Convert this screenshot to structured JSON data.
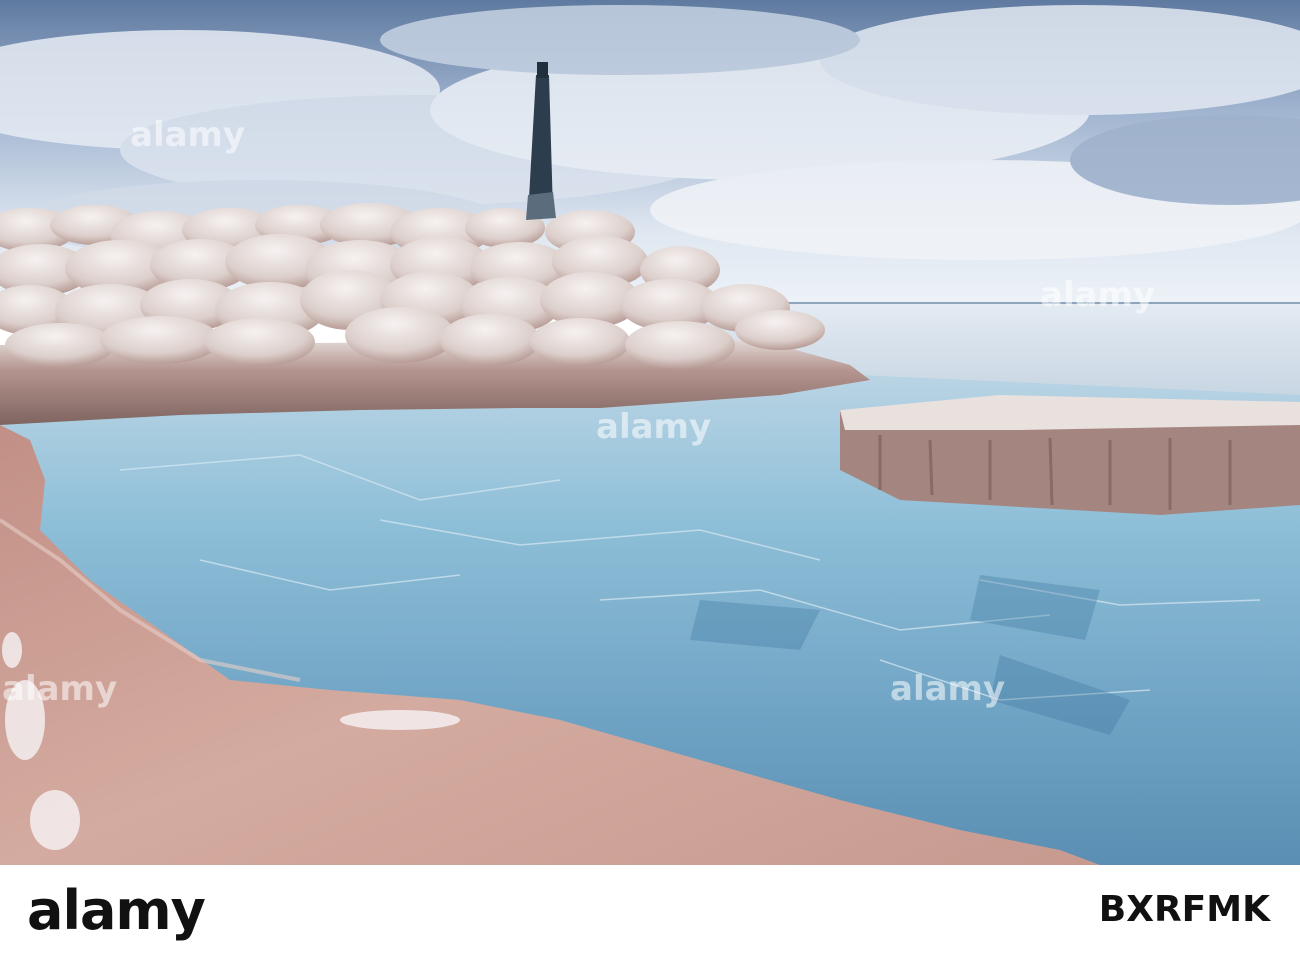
{
  "photo": {
    "subject": "frozen harbor with ice-covered breakwater rocks and a dark pole",
    "watermark_text": "alamy",
    "colors": {
      "sky_top": "#6e86a8",
      "cloud": "#e9eef5",
      "ice_blue": "#7fb1cf",
      "ice_dark": "#4f86ab",
      "shore_pink": "#c99d92",
      "rock_snow": "#f1ece9",
      "pole": "#2c3d4d"
    }
  },
  "footer": {
    "logo": "alamy",
    "image_id": "BXRFMK"
  }
}
